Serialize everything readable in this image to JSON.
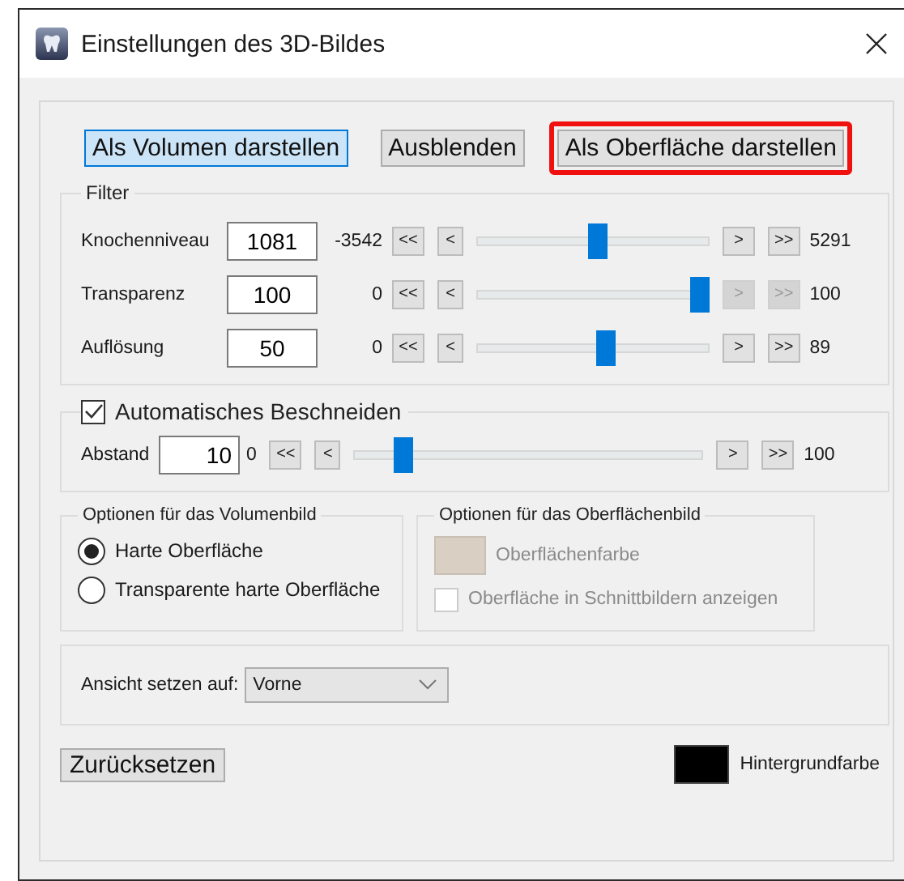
{
  "window": {
    "title": "Einstellungen des 3D-Bildes"
  },
  "mode_buttons": [
    {
      "label": "Als Volumen darstellen",
      "selected": true,
      "highlighted": false
    },
    {
      "label": "Ausblenden",
      "selected": false,
      "highlighted": false
    },
    {
      "label": "Als Oberfläche darstellen",
      "selected": false,
      "highlighted": true
    }
  ],
  "filter": {
    "title": "Filter",
    "rows": [
      {
        "label": "Knochenniveau",
        "value": "1081",
        "min": "-3542",
        "max": "5291",
        "level": 0.52,
        "step_buttons": [
          {
            "label": "<<",
            "disabled": false
          },
          {
            "label": "<",
            "disabled": false
          },
          {
            "label": ">",
            "disabled": false
          },
          {
            "label": ">>",
            "disabled": false
          }
        ]
      },
      {
        "label": "Transparenz",
        "value": "100",
        "min": "0",
        "max": "100",
        "level": 1.0,
        "step_buttons": [
          {
            "label": "<<",
            "disabled": false
          },
          {
            "label": "<",
            "disabled": false
          },
          {
            "label": ">",
            "disabled": true
          },
          {
            "label": ">>",
            "disabled": true
          }
        ]
      },
      {
        "label": "Auflösung",
        "value": "50",
        "min": "0",
        "max": "89",
        "level": 0.56,
        "step_buttons": [
          {
            "label": "<<",
            "disabled": false
          },
          {
            "label": "<",
            "disabled": false
          },
          {
            "label": ">",
            "disabled": false
          },
          {
            "label": ">>",
            "disabled": false
          }
        ]
      }
    ]
  },
  "auto_crop": {
    "label": "Automatisches Beschneiden",
    "checked": true,
    "rows": [
      {
        "label": "Abstand",
        "value": "10",
        "min": "0",
        "max": "100",
        "level": 0.12,
        "step_buttons": [
          {
            "label": "<<",
            "disabled": false
          },
          {
            "label": "<",
            "disabled": false
          },
          {
            "label": ">",
            "disabled": false
          },
          {
            "label": ">>",
            "disabled": false
          }
        ]
      }
    ]
  },
  "volume_options": {
    "title": "Optionen für das Volumenbild",
    "options": [
      {
        "label": "Harte Oberfläche",
        "selected": true
      },
      {
        "label": "Transparente harte Oberfläche",
        "selected": false
      }
    ]
  },
  "surface_options": {
    "title": "Optionen für das Oberflächenbild",
    "disabled": true,
    "color_button": {
      "label": "Oberflächenfarbe",
      "color": "#d9cfc3"
    },
    "show_in_slices": {
      "label": "Oberfläche in Schnittbildern anzeigen",
      "checked": false
    }
  },
  "view": {
    "label": "Ansicht setzen auf:",
    "value": "Vorne"
  },
  "reset_button": "Zurücksetzen",
  "background": {
    "label": "Hintergrundfarbe",
    "color": "#000000"
  }
}
